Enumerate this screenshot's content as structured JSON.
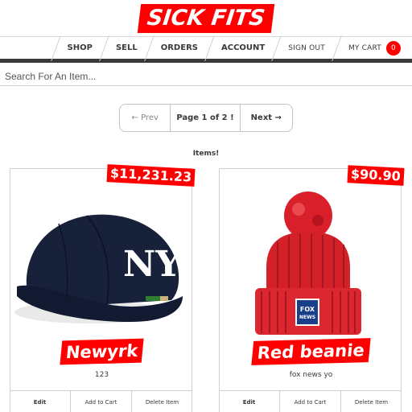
{
  "header": {
    "logo": "SICK FITS"
  },
  "nav": {
    "shop": "SHOP",
    "sell": "SELL",
    "orders": "ORDERS",
    "account": "ACCOUNT",
    "sign_out": "SIGN OUT",
    "my_cart": "MY CART",
    "cart_count": "0"
  },
  "search": {
    "placeholder": "Search For An Item...",
    "value": ""
  },
  "pagination": {
    "prev": "← Prev",
    "info": "Page 1 of 2 !",
    "next": "Next →"
  },
  "items_heading": "Items!",
  "items": [
    {
      "price": "$11,231.23",
      "title": "Newyrk",
      "description": "123",
      "image": "navy-baseball-cap",
      "actions": {
        "edit": "Edit",
        "add_to_cart": "Add to Cart",
        "delete": "Delete Item"
      }
    },
    {
      "price": "$90.90",
      "title": "Red beanie",
      "description": "fox news yo",
      "image": "red-pom-beanie",
      "actions": {
        "edit": "Edit",
        "add_to_cart": "Add to Cart",
        "delete": "Delete Item"
      }
    }
  ],
  "colors": {
    "accent": "#ff0000",
    "text": "#393939",
    "border": "#d0d0d0"
  }
}
